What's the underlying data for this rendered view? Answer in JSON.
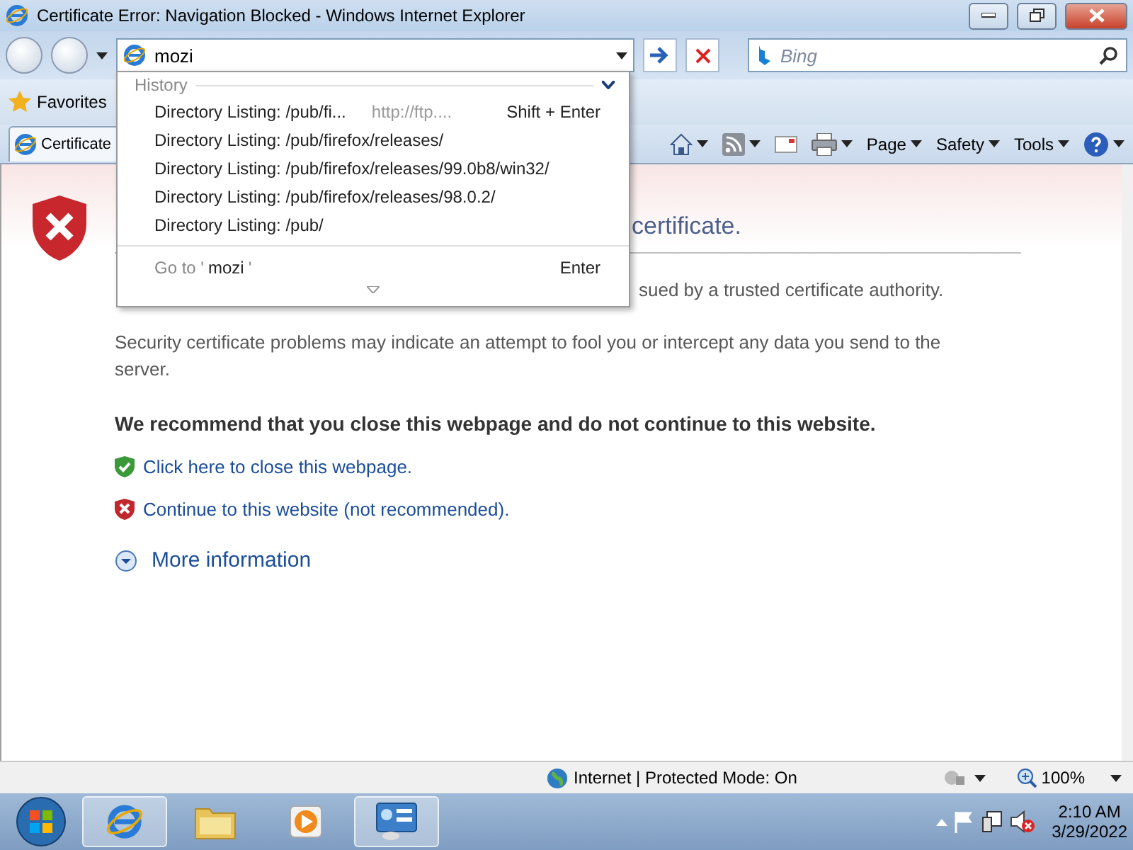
{
  "window": {
    "title": "Certificate Error: Navigation Blocked - Windows Internet Explorer"
  },
  "address": {
    "value": "mozi"
  },
  "search": {
    "placeholder": "Bing"
  },
  "favorites": {
    "label": "Favorites"
  },
  "tab": {
    "label": "Certificate"
  },
  "commands": [
    {
      "kind": "home"
    },
    {
      "kind": "feeds"
    },
    {
      "kind": "mail"
    },
    {
      "kind": "print"
    },
    {
      "kind": "menu",
      "label": "Page"
    },
    {
      "kind": "menu",
      "label": "Safety"
    },
    {
      "kind": "menu",
      "label": "Tools"
    },
    {
      "kind": "help"
    }
  ],
  "dropdown": {
    "section": "History",
    "items": [
      {
        "title": "Directory Listing: /pub/fi...",
        "url": "http://ftp....",
        "shortcut": "Shift + Enter"
      },
      {
        "title": "Directory Listing: /pub/firefox/releases/"
      },
      {
        "title": "Directory Listing: /pub/firefox/releases/99.0b8/win32/"
      },
      {
        "title": "Directory Listing: /pub/firefox/releases/98.0.2/"
      },
      {
        "title": "Directory Listing: /pub/"
      }
    ],
    "go_prefix": "Go to '",
    "go_query": "mozi",
    "go_suffix": "'",
    "go_shortcut": "Enter"
  },
  "content": {
    "heading_visible": "certificate.",
    "line_visible": "sued by a trusted certificate authority.",
    "paragraph": "Security certificate problems may indicate an attempt to fool you or intercept any data you send to the server.",
    "recommendation": "We recommend that you close this webpage and do not continue to this website.",
    "links": [
      {
        "kind": "safe",
        "label": "Click here to close this webpage."
      },
      {
        "kind": "danger",
        "label": "Continue to this website (not recommended)."
      }
    ],
    "more": "More information"
  },
  "status_bar": {
    "zone": "Internet | Protected Mode: On",
    "zoom": "100%"
  },
  "taskbar": {
    "items": [
      {
        "kind": "ie",
        "active": true
      },
      {
        "kind": "folder",
        "active": false
      },
      {
        "kind": "media",
        "active": false
      },
      {
        "kind": "control",
        "active": true
      }
    ],
    "time": "2:10 AM",
    "date": "3/29/2022"
  }
}
